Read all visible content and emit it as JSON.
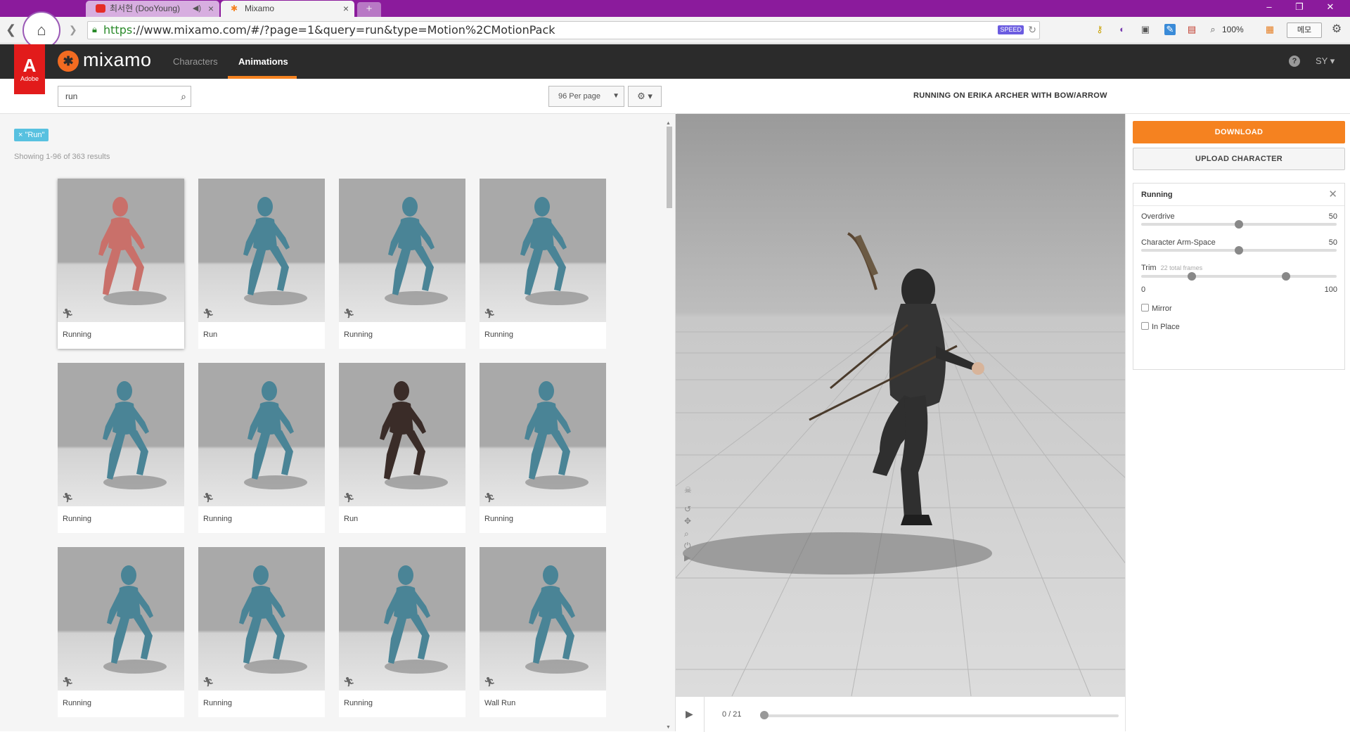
{
  "browser": {
    "tabs": [
      {
        "label": "최서현 (DooYoung)",
        "active": false
      },
      {
        "label": "Mixamo",
        "active": true
      }
    ],
    "new_tab": "+",
    "url_scheme": "https",
    "url_rest": "://www.mixamo.com/#/?page=1&query=run&type=Motion%2CMotionPack",
    "speed_badge": "SPEED",
    "zoom": "100%",
    "note_button": "메모",
    "icons": [
      "back-icon",
      "forward-icon",
      "home-icon",
      "lock-icon",
      "reload-icon",
      "key-icon",
      "extension-icon",
      "menu-icon"
    ]
  },
  "app": {
    "brand": "mixamo",
    "adobe_label": "Adobe",
    "nav": [
      {
        "label": "Characters",
        "active": false
      },
      {
        "label": "Animations",
        "active": true
      }
    ],
    "user_initials": "SY",
    "accent_color": "#f58220"
  },
  "search": {
    "query": "run",
    "per_page": "96 Per page",
    "filter_tag": "× \"Run\"",
    "results_text": "Showing 1-96 of 363 results"
  },
  "animations": [
    {
      "label": "Running",
      "selected": true
    },
    {
      "label": "Run",
      "selected": false
    },
    {
      "label": "Running",
      "selected": false
    },
    {
      "label": "Running",
      "selected": false
    },
    {
      "label": "Running",
      "selected": false
    },
    {
      "label": "Running",
      "selected": false
    },
    {
      "label": "Run",
      "selected": false
    },
    {
      "label": "Running",
      "selected": false
    },
    {
      "label": "Running",
      "selected": false
    },
    {
      "label": "Running",
      "selected": false
    },
    {
      "label": "Running",
      "selected": false
    },
    {
      "label": "Wall Run",
      "selected": false
    }
  ],
  "preview": {
    "title": "RUNNING ON ERIKA ARCHER WITH BOW/ARROW",
    "frame_display": "0 / 21",
    "current_frame": 0,
    "total_frames": 21
  },
  "side": {
    "download_label": "DOWNLOAD",
    "upload_label": "UPLOAD CHARACTER",
    "settings_title": "Running",
    "overdrive_label": "Overdrive",
    "overdrive_value": "50",
    "armspace_label": "Character Arm-Space",
    "armspace_value": "50",
    "trim_label": "Trim",
    "trim_sub": "22 total frames",
    "trim_min": "0",
    "trim_max": "100",
    "trim_start_fraction": 0.26,
    "trim_end_fraction": 0.74,
    "mirror_label": "Mirror",
    "inplace_label": "In Place"
  }
}
